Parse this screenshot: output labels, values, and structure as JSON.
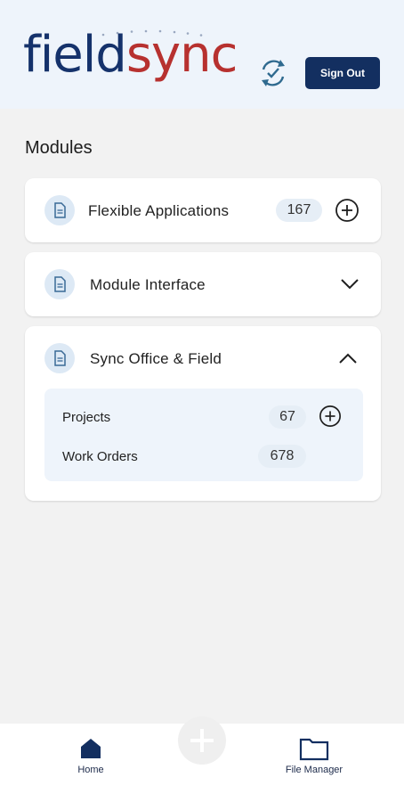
{
  "header": {
    "logo": {
      "part1": "field",
      "part2": "sync"
    },
    "sign_out_label": "Sign Out"
  },
  "modules": {
    "title": "Modules",
    "items": [
      {
        "label": "Flexible Applications",
        "count": "167",
        "state": "add"
      },
      {
        "label": "Module Interface",
        "state": "collapsed"
      },
      {
        "label": "Sync Office & Field",
        "state": "expanded",
        "children": [
          {
            "label": "Projects",
            "count": "67",
            "has_add": true
          },
          {
            "label": "Work Orders",
            "count": "678",
            "has_add": false
          }
        ]
      }
    ]
  },
  "bottom_nav": {
    "items": [
      {
        "label": "Home",
        "icon": "home-icon",
        "active": true
      },
      {
        "label": "File Manager",
        "icon": "folder-icon",
        "active": false
      }
    ],
    "fab_icon": "plus-icon"
  },
  "colors": {
    "brand_navy": "#132f60",
    "brand_red": "#b7312f",
    "header_bg": "#eef4fb",
    "page_bg": "#f2f2f2"
  }
}
